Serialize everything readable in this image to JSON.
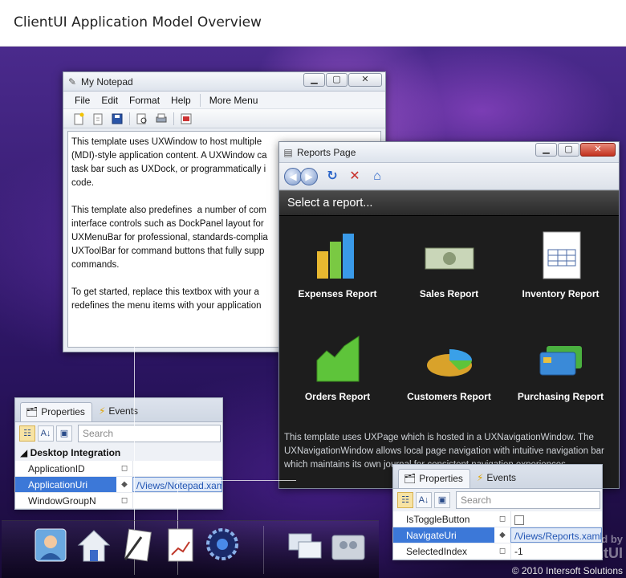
{
  "header": {
    "title": "ClientUI Application Model Overview"
  },
  "notepad": {
    "title": "My Notepad",
    "window_buttons": [
      "▁",
      "▢",
      "✕"
    ],
    "menu": [
      "File",
      "Edit",
      "Format",
      "Help",
      "More Menu"
    ],
    "content": "This template uses UXWindow to host multiple\n(MDI)-style application content. A UXWindow ca\ntask bar such as UXDock, or programmatically i\ncode.\n\nThis template also predefines  a number of com\ninterface controls such as DockPanel layout for\nUXMenuBar for professional, standards-complia\nUXToolBar for command buttons that fully supp\ncommands.\n\nTo get started, replace this textbox with your a\nredefines the menu items with your application"
  },
  "reports": {
    "title": "Reports Page",
    "window_buttons": [
      "▁",
      "▢",
      "✕"
    ],
    "select_label": "Select a report...",
    "items": [
      {
        "label": "Expenses Report"
      },
      {
        "label": "Sales Report"
      },
      {
        "label": "Inventory Report"
      },
      {
        "label": "Orders Report"
      },
      {
        "label": "Customers Report"
      },
      {
        "label": "Purchasing Report"
      }
    ],
    "description": "This template uses UXPage which is hosted in a UXNavigationWindow. The UXNavigationWindow allows local page navigation with intuitive navigation bar which maintains its own journal for consistent navigation experiences."
  },
  "props1": {
    "tabs": [
      "Properties",
      "Events"
    ],
    "search_placeholder": "Search",
    "category": "Desktop Integration",
    "rows": [
      {
        "name": "ApplicationID",
        "value": ""
      },
      {
        "name": "ApplicationUri",
        "value": "/Views/Notepad.xaml"
      },
      {
        "name": "WindowGroupN",
        "value": ""
      }
    ]
  },
  "props2": {
    "tabs": [
      "Properties",
      "Events"
    ],
    "search_placeholder": "Search",
    "rows": [
      {
        "name": "IsToggleButton",
        "value": ""
      },
      {
        "name": "NavigateUri",
        "value": "/Views/Reports.xaml"
      },
      {
        "name": "SelectedIndex",
        "value": "-1"
      }
    ]
  },
  "brand": {
    "line1": "d by",
    "line2": "ClientUI"
  },
  "copyright": "© 2010 Intersoft Solutions"
}
